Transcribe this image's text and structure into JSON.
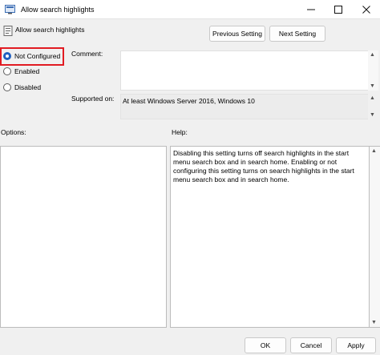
{
  "window": {
    "title": "Allow search highlights",
    "title_icon": "policy-icon",
    "controls": [
      "minimize-icon",
      "maximize-icon",
      "close-icon"
    ]
  },
  "header": {
    "policy_name": "Allow search highlights",
    "policy_icon": "policy-setting-icon",
    "prev_label": "Previous Setting",
    "next_label": "Next Setting"
  },
  "state": {
    "options": [
      {
        "label": "Not Configured",
        "selected": true
      },
      {
        "label": "Enabled",
        "selected": false
      },
      {
        "label": "Disabled",
        "selected": false
      }
    ],
    "highlight_color": "#e11b22",
    "accent_color": "#1f5fbf"
  },
  "comment": {
    "label": "Comment:",
    "value": ""
  },
  "supported": {
    "label": "Supported on:",
    "value": "At least Windows Server 2016, Windows 10"
  },
  "options_panel": {
    "label": "Options:"
  },
  "help_panel": {
    "label": "Help:",
    "text": "Disabling this setting turns off search highlights in the start menu search box and in search home. Enabling or not configuring this setting turns on search highlights in the start menu search box and in search home."
  },
  "footer": {
    "ok_label": "OK",
    "cancel_label": "Cancel",
    "apply_label": "Apply"
  }
}
